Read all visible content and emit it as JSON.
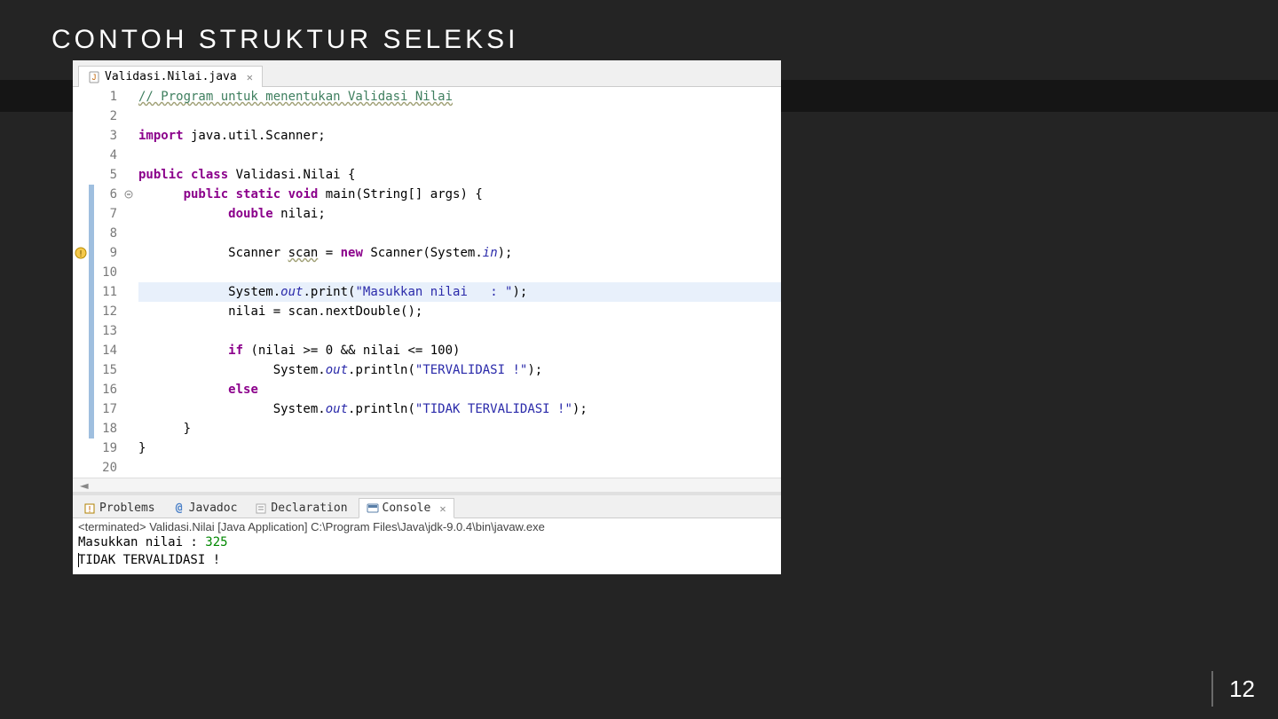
{
  "slide": {
    "title": "CONTOH STRUKTUR SELEKSI",
    "page_number": "12"
  },
  "editor": {
    "tab_label": "Validasi.Nilai.java",
    "line_count": 20,
    "highlighted_line": 11,
    "fold_marker_line": 6,
    "warning_marker_line": 9,
    "vchange_lines": [
      6,
      7,
      8,
      9,
      10,
      11,
      12,
      13,
      14,
      15,
      16,
      17,
      18
    ],
    "code": {
      "l1_comment": "// Program untuk menentukan Validasi Nilai",
      "l3_import": "import",
      "l3_pkg": " java.util.Scanner;",
      "l5_public": "public ",
      "l5_class": "class ",
      "l5_name": "Validasi.Nilai {",
      "l6_public": "public ",
      "l6_static": "static ",
      "l6_void": "void ",
      "l6_main": "main(String[] args) {",
      "l7_double": "double ",
      "l7_var": "nilai;",
      "l9_scanner": "Scanner ",
      "l9_scan": "scan",
      "l9_eq": " = ",
      "l9_new": "new ",
      "l9_rest": "Scanner(System.",
      "l9_in": "in",
      "l9_end": ");",
      "l11_sysout": "System.",
      "l11_out": "out",
      "l11_print": ".print(",
      "l11_str": "\"Masukkan nilai   : \"",
      "l11_end": ");",
      "l12_assign": "nilai = scan.nextDouble();",
      "l14_if": "if ",
      "l14_cond": "(nilai >= 0 && nilai <= 100)",
      "l15_sysout": "System.",
      "l15_out": "out",
      "l15_print": ".println(",
      "l15_str": "\"TERVALIDASI !\"",
      "l15_end": ");",
      "l16_else": "else",
      "l17_sysout": "System.",
      "l17_out": "out",
      "l17_print": ".println(",
      "l17_str": "\"TIDAK TERVALIDASI !\"",
      "l17_end": ");",
      "l18_brace": "}",
      "l19_brace": "}"
    }
  },
  "bottom_tabs": {
    "problems": "Problems",
    "javadoc": "Javadoc",
    "declaration": "Declaration",
    "console": "Console"
  },
  "console": {
    "header": "<terminated> Validasi.Nilai [Java Application] C:\\Program Files\\Java\\jdk-9.0.4\\bin\\javaw.exe",
    "prompt": "Masukkan nilai   : ",
    "input_value": "325",
    "output": "TIDAK TERVALIDASI !"
  }
}
